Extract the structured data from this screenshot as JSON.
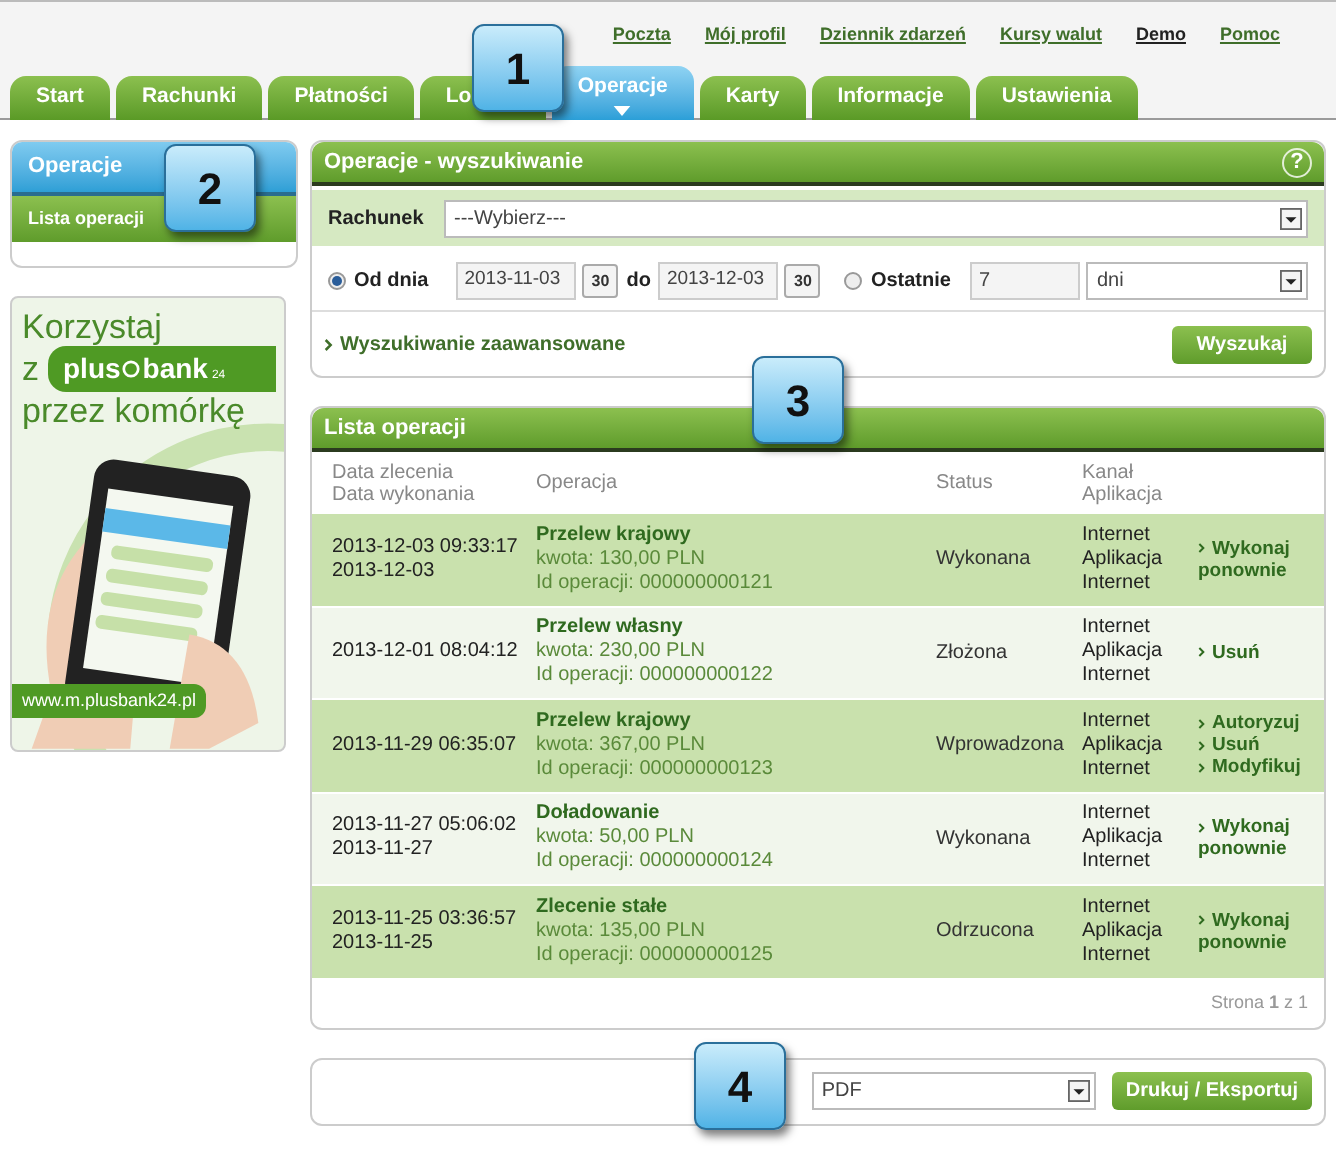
{
  "top_links": [
    {
      "label": "Poczta",
      "kind": "link"
    },
    {
      "label": "Mój profil",
      "kind": "link"
    },
    {
      "label": "Dziennik zdarzeń",
      "kind": "link"
    },
    {
      "label": "Kursy walut",
      "kind": "link"
    },
    {
      "label": "Demo",
      "kind": "user"
    },
    {
      "label": "Pomoc",
      "kind": "link"
    }
  ],
  "tabs": [
    {
      "label": "Start",
      "selected": false
    },
    {
      "label": "Rachunki",
      "selected": false
    },
    {
      "label": "Płatności",
      "selected": false
    },
    {
      "label": "Lo",
      "selected": false
    },
    {
      "label": "Operacje",
      "selected": true
    },
    {
      "label": "Karty",
      "selected": false
    },
    {
      "label": "Informacje",
      "selected": false
    },
    {
      "label": "Ustawienia",
      "selected": false
    }
  ],
  "sidebar": {
    "title": "Operacje",
    "items": [
      {
        "label": "Lista operacji",
        "selected": true
      }
    ]
  },
  "ad": {
    "line_1": "Korzystaj",
    "line_2": "z",
    "logo_left": "plus",
    "logo_right": "bank",
    "logo_sub": "24",
    "line_3": "przez komórkę",
    "url": "www.m.plusbank24.pl"
  },
  "search": {
    "title": "Operacje - wyszukiwanie",
    "help": "?",
    "account_label": "Rachunek",
    "account_value": "---Wybierz---",
    "radios": [
      {
        "label": "Od dnia",
        "selected": true
      },
      {
        "label": "Ostatnie",
        "selected": false
      }
    ],
    "from": "2013-11-03",
    "calendar_1": "30",
    "to_label": "do",
    "to": "2013-12-03",
    "calendar_2": "30",
    "last_count": "7",
    "unit": "dni",
    "advanced": "Wyszukiwanie zaawansowane",
    "search_button": "Wyszukaj"
  },
  "list": {
    "title": "Lista operacji",
    "columns": [
      [
        "Data zlecenia",
        "Data wykonania"
      ],
      [
        "Operacja"
      ],
      [
        "Status"
      ],
      [
        "Kanał",
        "Aplikacja"
      ]
    ],
    "rows": [
      {
        "dates": [
          "2013-12-03 09:33:17",
          "2013-12-03"
        ],
        "operation": "Przelew krajowy",
        "amount": "kwota: 130,00 PLN",
        "id": "Id operacji: 000000000121",
        "status": "Wykonana",
        "channel": [
          "Internet",
          "Aplikacja",
          "Internet"
        ],
        "actions": [
          "Wykonaj ponownie"
        ]
      },
      {
        "dates": [
          "2013-12-01 08:04:12"
        ],
        "operation": "Przelew własny",
        "amount": "kwota: 230,00 PLN",
        "id": "Id operacji: 000000000122",
        "status": "Złożona",
        "channel": [
          "Internet",
          "Aplikacja",
          "Internet"
        ],
        "actions": [
          "Usuń"
        ]
      },
      {
        "dates": [
          "2013-11-29 06:35:07"
        ],
        "operation": "Przelew krajowy",
        "amount": "kwota: 367,00 PLN",
        "id": "Id operacji: 000000000123",
        "status": "Wprowadzona",
        "channel": [
          "Internet",
          "Aplikacja",
          "Internet"
        ],
        "actions": [
          "Autoryzuj",
          "Usuń",
          "Modyfikuj"
        ]
      },
      {
        "dates": [
          "2013-11-27 05:06:02",
          "2013-11-27"
        ],
        "operation": "Doładowanie",
        "amount": "kwota: 50,00 PLN",
        "id": "Id operacji: 000000000124",
        "status": "Wykonana",
        "channel": [
          "Internet",
          "Aplikacja",
          "Internet"
        ],
        "actions": [
          "Wykonaj ponownie"
        ]
      },
      {
        "dates": [
          "2013-11-25 03:36:57",
          "2013-11-25"
        ],
        "operation": "Zlecenie stałe",
        "amount": "kwota: 135,00 PLN",
        "id": "Id operacji: 000000000125",
        "status": "Odrzucona",
        "channel": [
          "Internet",
          "Aplikacja",
          "Internet"
        ],
        "actions": [
          "Wykonaj ponownie"
        ]
      }
    ],
    "pager": "Strona **1** z 1"
  },
  "export": {
    "format": "PDF",
    "button": "Drukuj / Eksportuj"
  },
  "callouts": [
    "1",
    "2",
    "3",
    "4"
  ]
}
